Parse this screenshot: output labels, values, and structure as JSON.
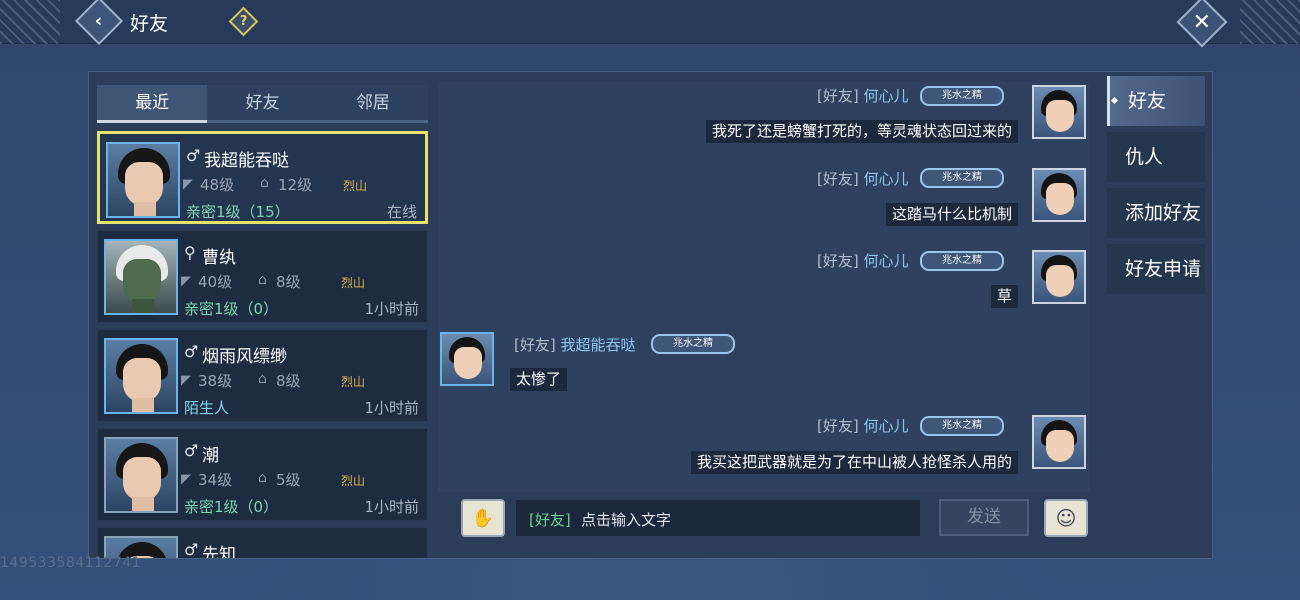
{
  "topbar": {
    "title": "好友",
    "back_glyph": "‹",
    "help_glyph": "?",
    "close_glyph": "✕"
  },
  "tabs": [
    {
      "label": "最近",
      "active": true
    },
    {
      "label": "好友",
      "active": false
    },
    {
      "label": "邻居",
      "active": false
    }
  ],
  "friends": [
    {
      "gender": "♂",
      "name": "我超能吞哒",
      "level": "48级",
      "guild": "12级",
      "sect": "烈山",
      "intimacy": "亲密1级（15）",
      "status": "在线",
      "selected": true
    },
    {
      "gender": "⚲",
      "name": "曹纨",
      "level": "40级",
      "guild": "8级",
      "sect": "烈山",
      "intimacy": "亲密1级（0）",
      "status": "1小时前",
      "selected": false
    },
    {
      "gender": "♂",
      "name": "烟雨风缥缈",
      "level": "38级",
      "guild": "8级",
      "sect": "烈山",
      "intimacy": "陌生人",
      "status": "1小时前",
      "selected": false
    },
    {
      "gender": "♂",
      "name": "潮",
      "level": "34级",
      "guild": "5级",
      "sect": "烈山",
      "intimacy": "亲密1级（0）",
      "status": "1小时前",
      "selected": false
    },
    {
      "gender": "♂",
      "name": "先知",
      "level": "",
      "guild": "",
      "sect": "",
      "intimacy": "",
      "status": "",
      "selected": false
    }
  ],
  "messages": [
    {
      "channel": "[好友]",
      "sender": "何心儿",
      "badge": "兆水之精",
      "text": "我死了还是螃蟹打死的，等灵魂状态回过来的",
      "side": "right"
    },
    {
      "channel": "[好友]",
      "sender": "何心儿",
      "badge": "兆水之精",
      "text": "这踏马什么比机制",
      "side": "right"
    },
    {
      "channel": "[好友]",
      "sender": "何心儿",
      "badge": "兆水之精",
      "text": "草",
      "side": "right"
    },
    {
      "channel": "[好友]",
      "sender": "我超能吞哒",
      "badge": "兆水之精",
      "text": "太惨了",
      "side": "left"
    },
    {
      "channel": "[好友]",
      "sender": "何心儿",
      "badge": "兆水之精",
      "text": "我买这把武器就是为了在中山被人抢怪杀人用的",
      "side": "right"
    }
  ],
  "input": {
    "channel": "[好友]",
    "placeholder": "点击输入文字",
    "send_label": "发送"
  },
  "right_nav": [
    {
      "label": "好友",
      "active": true
    },
    {
      "label": "仇人",
      "active": false
    },
    {
      "label": "添加好友",
      "active": false
    },
    {
      "label": "好友申请",
      "active": false
    }
  ],
  "watermark": "149533584112741",
  "colors": {
    "background": "#2f4466",
    "selected_border": "#e7e36a",
    "intimacy_text": "#7dd6b0",
    "sender_name": "#8fc4f2",
    "sect_text": "#d8b24a"
  }
}
